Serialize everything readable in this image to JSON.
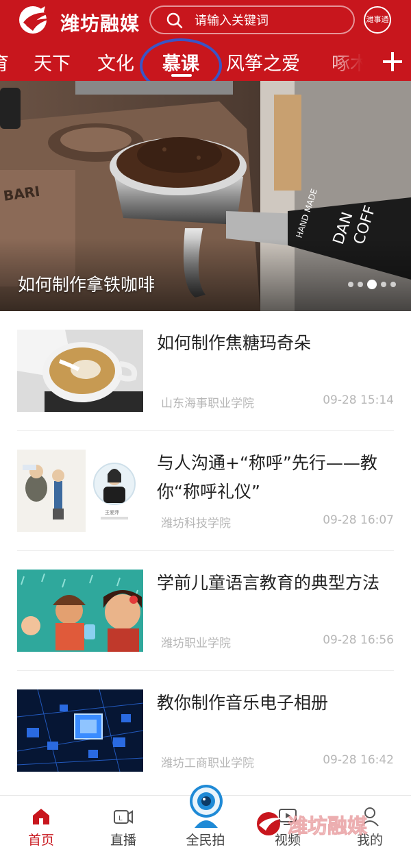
{
  "colors": {
    "brand_red": "#c8161d",
    "annotation_blue": "#3a55c6",
    "muted_text": "#b7b7b7"
  },
  "header": {
    "logo_text": "潍坊融媒",
    "search_placeholder": "请输入关键词",
    "user_badge": "潍事通",
    "tabs": [
      {
        "label": "育",
        "active": false
      },
      {
        "label": "天下",
        "active": false
      },
      {
        "label": "文化",
        "active": false
      },
      {
        "label": "慕课",
        "active": true
      },
      {
        "label": "风筝之爱",
        "active": false
      },
      {
        "label": "啄木",
        "active": false
      }
    ],
    "add_icon": "plus-icon"
  },
  "banner": {
    "caption": "如何制作拿铁咖啡",
    "slides_count": 5,
    "active_slide": 3,
    "image_text": [
      "HAND MADE",
      "DAN",
      "COFF",
      "BARI"
    ]
  },
  "articles": [
    {
      "title": "如何制作焦糖玛奇朵",
      "source": "山东海事职业学院",
      "time": "09-28 15:14",
      "thumb": "latte-art"
    },
    {
      "title": "与人沟通+“称呼”先行——教你“称呼礼仪”",
      "source": "潍坊科技学院",
      "time": "09-28 16:07",
      "thumb": "etiquette-lecture",
      "thumb_text": "王爱萍"
    },
    {
      "title": "学前儿童语言教育的典型方法",
      "source": "潍坊职业学院",
      "time": "09-28 16:56",
      "thumb": "cartoon-children"
    },
    {
      "title": "教你制作音乐电子相册",
      "source": "潍坊工商职业学院",
      "time": "09-28 16:42",
      "thumb": "circuit-chips"
    }
  ],
  "bottom_nav": [
    {
      "label": "首页",
      "icon": "home-icon",
      "active": true
    },
    {
      "label": "直播",
      "icon": "live-icon",
      "active": false
    },
    {
      "label": "全民拍",
      "icon": "camera-icon",
      "active": false
    },
    {
      "label": "视频",
      "icon": "video-icon",
      "active": false
    },
    {
      "label": "我的",
      "icon": "profile-icon",
      "active": false
    }
  ],
  "watermark": {
    "text": "潍坊融媒"
  }
}
